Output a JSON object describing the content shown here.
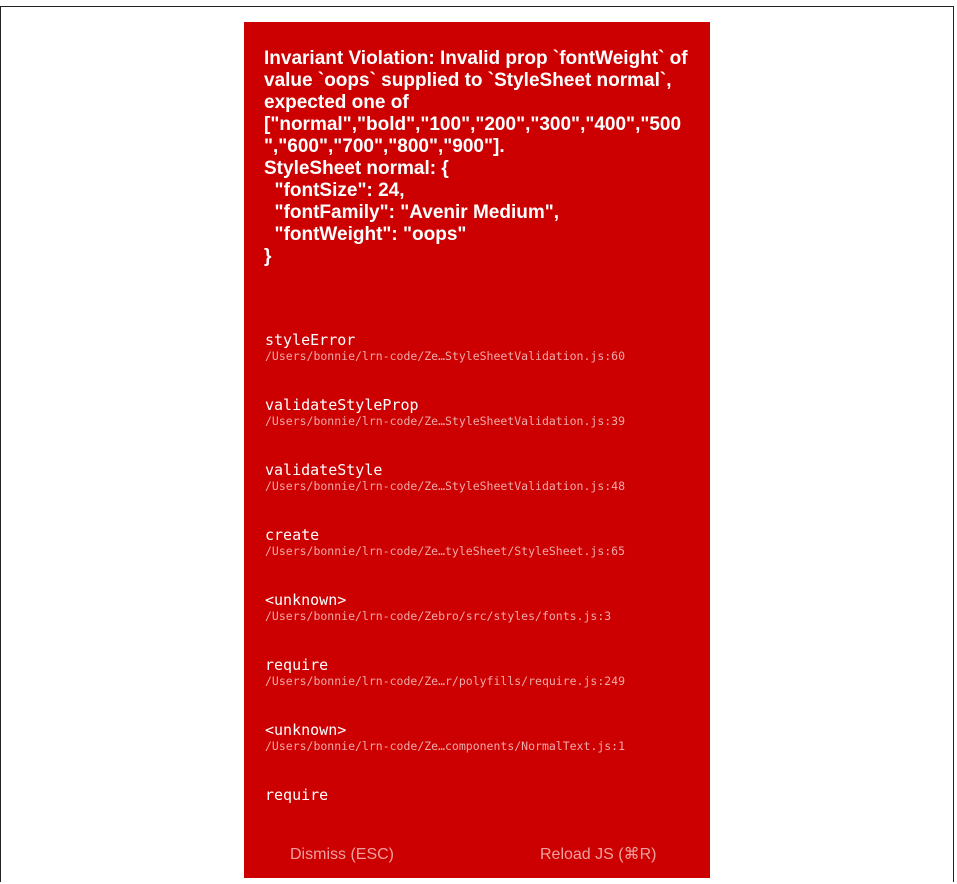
{
  "error": {
    "message": "Invariant Violation: Invalid prop `fontWeight` of\nvalue `oops` supplied to `StyleSheet normal`,\nexpected one of\n[\"normal\",\"bold\",\"100\",\"200\",\"300\",\"400\",\"500\n\",\"600\",\"700\",\"800\",\"900\"].\nStyleSheet normal: {\n  \"fontSize\": 24,\n  \"fontFamily\": \"Avenir Medium\",\n  \"fontWeight\": \"oops\"\n}"
  },
  "stack": [
    {
      "method": "styleError",
      "location": "/Users/bonnie/lrn-code/Ze…StyleSheetValidation.js:60"
    },
    {
      "method": "validateStyleProp",
      "location": "/Users/bonnie/lrn-code/Ze…StyleSheetValidation.js:39"
    },
    {
      "method": "validateStyle",
      "location": "/Users/bonnie/lrn-code/Ze…StyleSheetValidation.js:48"
    },
    {
      "method": "create",
      "location": "/Users/bonnie/lrn-code/Ze…tyleSheet/StyleSheet.js:65"
    },
    {
      "method": "<unknown>",
      "location": "/Users/bonnie/lrn-code/Zebro/src/styles/fonts.js:3"
    },
    {
      "method": "require",
      "location": "/Users/bonnie/lrn-code/Ze…r/polyfills/require.js:249"
    },
    {
      "method": "<unknown>",
      "location": "/Users/bonnie/lrn-code/Ze…components/NormalText.js:1"
    },
    {
      "method": "require",
      "location": ""
    }
  ],
  "buttons": {
    "dismiss_label": "Dismiss (ESC)",
    "reload_label": "Reload JS (⌘R)"
  },
  "colors": {
    "background": "#cc0000",
    "text": "#ffffff",
    "secondary_text": "#f1a9a9"
  }
}
